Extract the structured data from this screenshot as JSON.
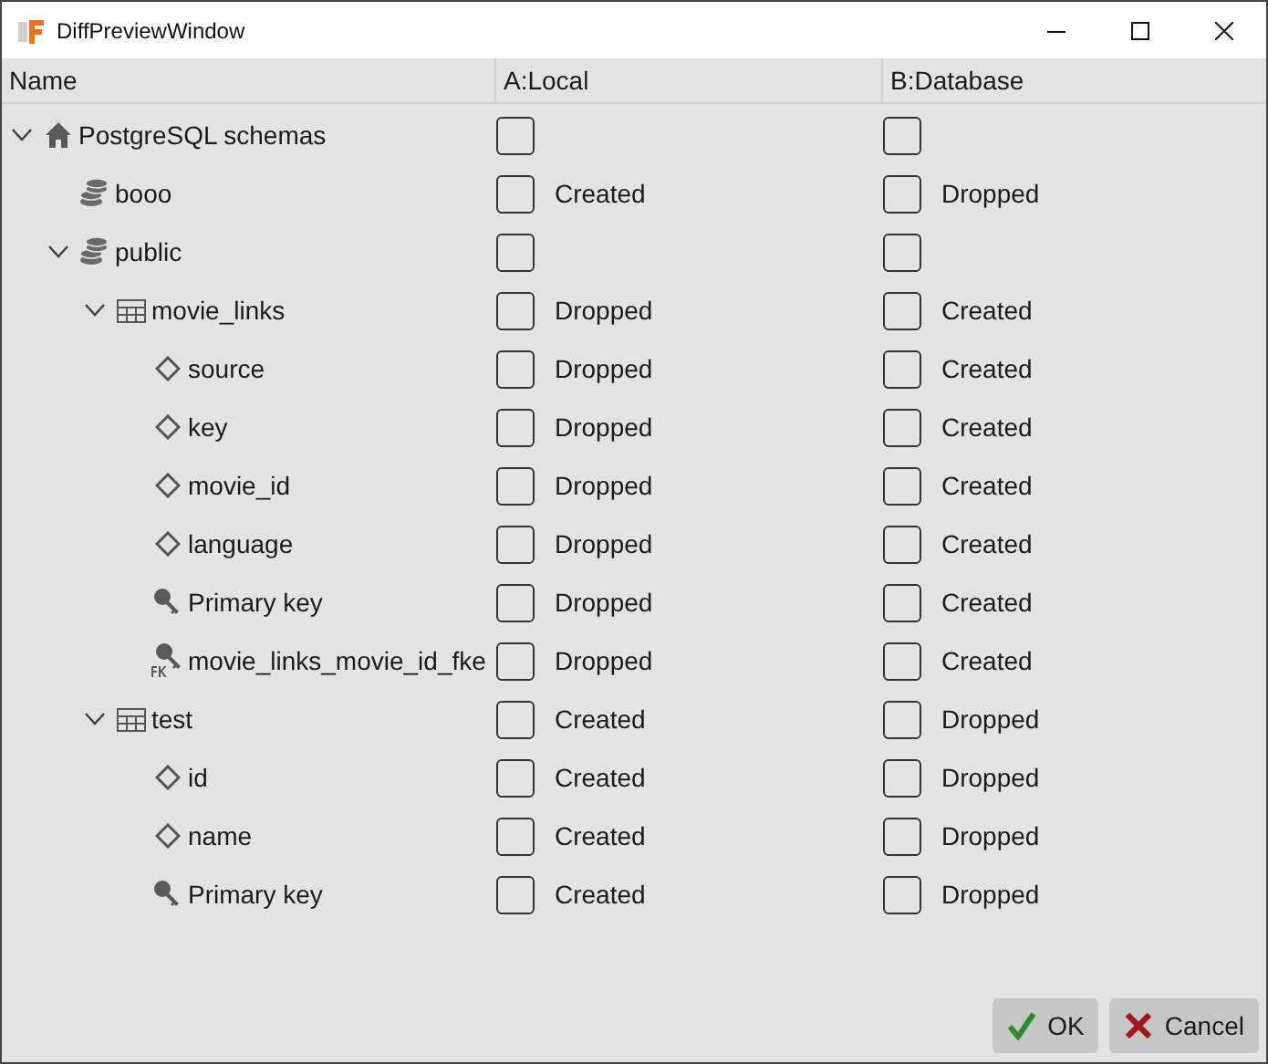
{
  "window": {
    "title": "DiffPreviewWindow"
  },
  "columns": [
    "Name",
    "A:Local",
    "B:Database"
  ],
  "tree": [
    {
      "name": "PostgreSQL schemas",
      "kind": "root",
      "expanded": true,
      "a_checked": false,
      "b_checked": false,
      "children": [
        {
          "name": "booo",
          "kind": "schema",
          "a_checked": false,
          "a_status": "Created",
          "b_checked": false,
          "b_status": "Dropped"
        },
        {
          "name": "public",
          "kind": "schema",
          "expanded": true,
          "a_checked": false,
          "b_checked": false,
          "children": [
            {
              "name": "movie_links",
              "kind": "table",
              "expanded": true,
              "a_checked": false,
              "a_status": "Dropped",
              "b_checked": false,
              "b_status": "Created",
              "children": [
                {
                  "name": "source",
                  "kind": "column",
                  "a_checked": false,
                  "a_status": "Dropped",
                  "b_checked": false,
                  "b_status": "Created"
                },
                {
                  "name": "key",
                  "kind": "column",
                  "a_checked": false,
                  "a_status": "Dropped",
                  "b_checked": false,
                  "b_status": "Created"
                },
                {
                  "name": "movie_id",
                  "kind": "column",
                  "a_checked": false,
                  "a_status": "Dropped",
                  "b_checked": false,
                  "b_status": "Created"
                },
                {
                  "name": "language",
                  "kind": "column",
                  "a_checked": false,
                  "a_status": "Dropped",
                  "b_checked": false,
                  "b_status": "Created"
                },
                {
                  "name": "Primary key",
                  "kind": "pk",
                  "a_checked": false,
                  "a_status": "Dropped",
                  "b_checked": false,
                  "b_status": "Created"
                },
                {
                  "name": "movie_links_movie_id_fke",
                  "kind": "fk",
                  "a_checked": false,
                  "a_status": "Dropped",
                  "b_checked": false,
                  "b_status": "Created"
                }
              ]
            },
            {
              "name": "test",
              "kind": "table",
              "expanded": true,
              "a_checked": false,
              "a_status": "Created",
              "b_checked": false,
              "b_status": "Dropped",
              "children": [
                {
                  "name": "id",
                  "kind": "column",
                  "a_checked": false,
                  "a_status": "Created",
                  "b_checked": false,
                  "b_status": "Dropped"
                },
                {
                  "name": "name",
                  "kind": "column",
                  "a_checked": false,
                  "a_status": "Created",
                  "b_checked": false,
                  "b_status": "Dropped"
                },
                {
                  "name": "Primary key",
                  "kind": "pk",
                  "a_checked": false,
                  "a_status": "Created",
                  "b_checked": false,
                  "b_status": "Dropped"
                }
              ]
            }
          ]
        }
      ]
    }
  ],
  "buttons": [
    {
      "label": "OK",
      "kind": "ok"
    },
    {
      "label": "Cancel",
      "kind": "cancel"
    }
  ]
}
